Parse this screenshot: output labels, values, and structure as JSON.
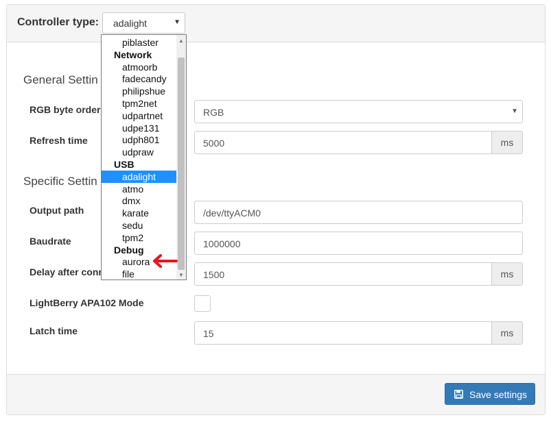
{
  "header": {
    "label": "Controller type:",
    "selected": "adalight"
  },
  "dropdown": {
    "options": [
      {
        "label": "piblaster",
        "type": "option"
      },
      {
        "label": "Network",
        "type": "group"
      },
      {
        "label": "atmoorb",
        "type": "option"
      },
      {
        "label": "fadecandy",
        "type": "option"
      },
      {
        "label": "philipshue",
        "type": "option"
      },
      {
        "label": "tpm2net",
        "type": "option"
      },
      {
        "label": "udpartnet",
        "type": "option"
      },
      {
        "label": "udpe131",
        "type": "option"
      },
      {
        "label": "udph801",
        "type": "option"
      },
      {
        "label": "udpraw",
        "type": "option"
      },
      {
        "label": "USB",
        "type": "group"
      },
      {
        "label": "adalight",
        "type": "option",
        "selected": true
      },
      {
        "label": "atmo",
        "type": "option"
      },
      {
        "label": "dmx",
        "type": "option"
      },
      {
        "label": "karate",
        "type": "option"
      },
      {
        "label": "sedu",
        "type": "option"
      },
      {
        "label": "tpm2",
        "type": "option"
      },
      {
        "label": "Debug",
        "type": "group"
      },
      {
        "label": "aurora",
        "type": "option"
      },
      {
        "label": "file",
        "type": "option"
      }
    ]
  },
  "general": {
    "title": "General Settin",
    "rgb_label": "RGB byte order",
    "rgb_value": "RGB",
    "refresh_label": "Refresh time",
    "refresh_value": "5000",
    "refresh_unit": "ms"
  },
  "specific": {
    "title": "Specific Settin",
    "output_label": "Output path",
    "output_value": "/dev/ttyACM0",
    "baud_label": "Baudrate",
    "baud_value": "1000000",
    "delay_label": "Delay after conn",
    "delay_value": "1500",
    "delay_unit": "ms",
    "lightberry_label": "LightBerry APA102 Mode",
    "latch_label": "Latch time",
    "latch_value": "15",
    "latch_unit": "ms"
  },
  "footer": {
    "save_label": "Save settings"
  },
  "colors": {
    "primary": "#337ab7",
    "selected_option": "#1e90ff",
    "annotation_arrow": "#e8141b"
  }
}
